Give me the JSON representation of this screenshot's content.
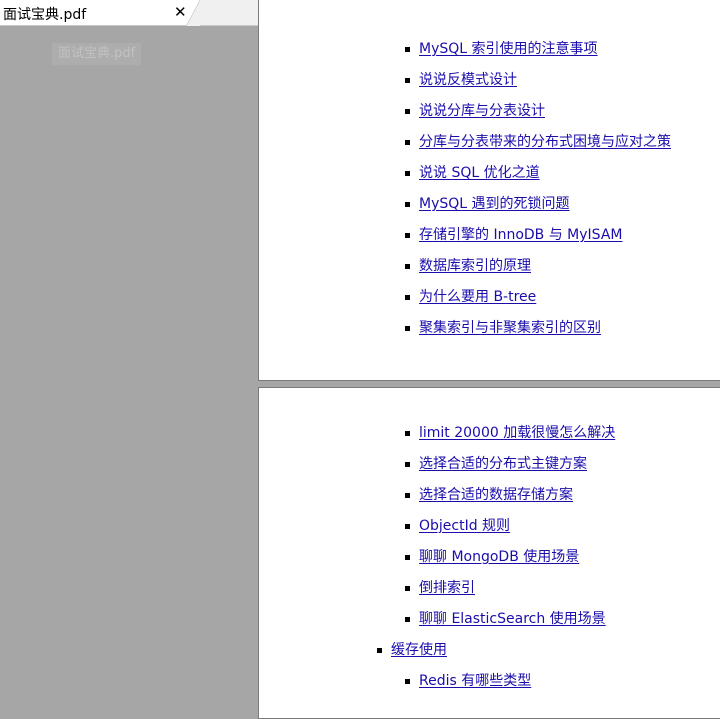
{
  "tab": {
    "title": "面试宝典.pdf",
    "close_label": "✕"
  },
  "sidebar": {
    "watermark": "面试宝典.pdf"
  },
  "page1": {
    "items": [
      "MySQL 索引使用的注意事项",
      "说说反模式设计",
      "说说分库与分表设计",
      "分库与分表带来的分布式困境与应对之策",
      "说说 SQL 优化之道",
      "MySQL 遇到的死锁问题",
      "存储引擎的 InnoDB 与 MyISAM",
      "数据库索引的原理",
      "为什么要用 B-tree",
      "聚集索引与非聚集索引的区别"
    ]
  },
  "page2": {
    "items": [
      {
        "text": "limit 20000 加载很慢怎么解决",
        "level": 2
      },
      {
        "text": "选择合适的分布式主键方案",
        "level": 2
      },
      {
        "text": "选择合适的数据存储方案",
        "level": 2
      },
      {
        "text": "ObjectId 规则",
        "level": 2
      },
      {
        "text": "聊聊 MongoDB 使用场景",
        "level": 2
      },
      {
        "text": "倒排索引",
        "level": 2
      },
      {
        "text": "聊聊 ElasticSearch 使用场景",
        "level": 2
      },
      {
        "text": "缓存使用",
        "level": 1
      },
      {
        "text": "Redis 有哪些类型",
        "level": 2
      }
    ]
  }
}
